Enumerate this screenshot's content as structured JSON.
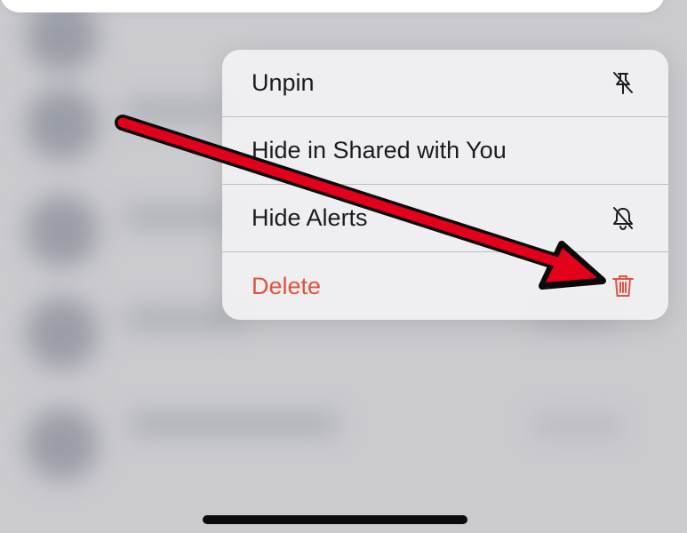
{
  "context_menu": {
    "items": [
      {
        "label": "Unpin",
        "icon": "unpin-icon",
        "destructive": false
      },
      {
        "label": "Hide in Shared with You",
        "icon": "",
        "destructive": false
      },
      {
        "label": "Hide Alerts",
        "icon": "bell-slash-icon",
        "destructive": false
      },
      {
        "label": "Delete",
        "icon": "trash-icon",
        "destructive": true
      }
    ]
  },
  "annotation": {
    "type": "arrow",
    "color": "#e3001b",
    "points_to": "trash-icon"
  },
  "colors": {
    "destructive": "#e0533e",
    "menu_background": "#f0f0f2",
    "arrow": "#e3001b"
  }
}
